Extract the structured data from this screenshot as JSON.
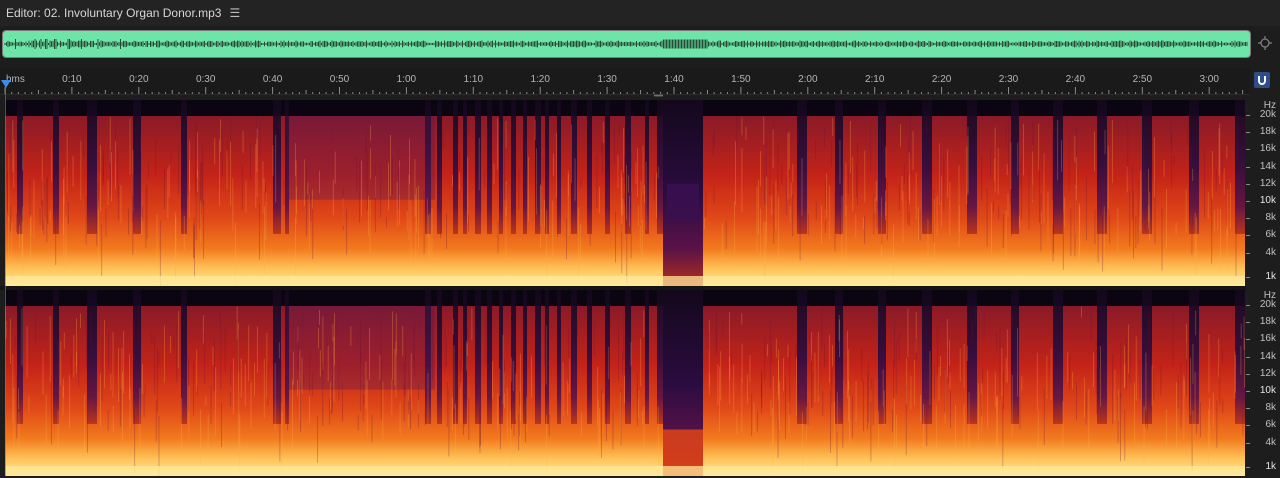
{
  "editor": {
    "title": "Editor: 02. Involuntary Organ Donor.mp3",
    "menu_icon": "hamburger-menu-icon"
  },
  "overview": {
    "waveform_color": "#6ee4a8",
    "zoom_icon": "zoom-to-fit-icon"
  },
  "ruler": {
    "unit_label": "hms",
    "ticks": [
      "0:10",
      "0:20",
      "0:30",
      "0:40",
      "0:50",
      "1:00",
      "1:10",
      "1:20",
      "1:30",
      "1:40",
      "1:50",
      "2:00",
      "2:10",
      "2:20",
      "2:30",
      "2:40",
      "2:50",
      "3:00"
    ],
    "snap_icon": "magnet-snap-icon"
  },
  "frequency_scale": {
    "unit": "Hz",
    "labels": [
      "20k",
      "18k",
      "16k",
      "14k",
      "12k",
      "10k",
      "8k",
      "6k",
      "4k",
      "1k"
    ]
  },
  "spectrogram": {
    "colors": {
      "background": "#0a0510",
      "low": "#3a1050",
      "mid": "#c01d1d",
      "high": "#f06a18",
      "peak": "#ffe89a"
    },
    "channels": [
      "left",
      "right"
    ]
  }
}
